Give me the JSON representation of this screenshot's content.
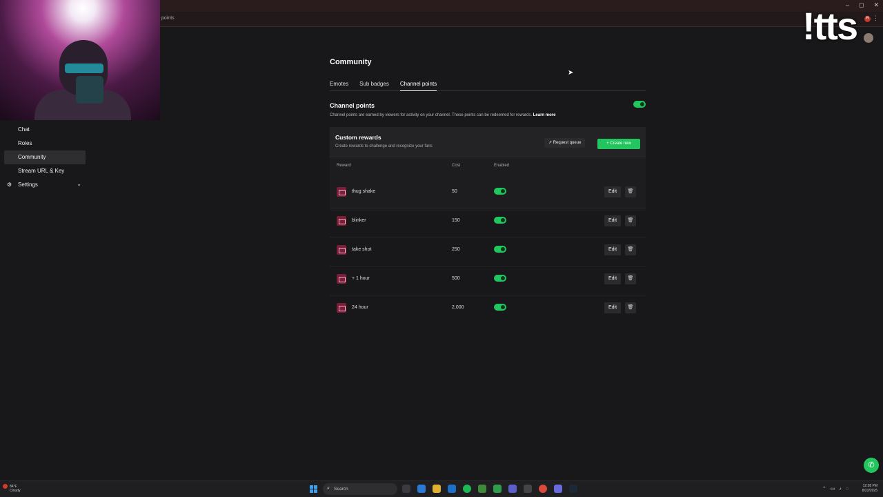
{
  "browser": {
    "url_fragment": "points",
    "window_controls": [
      "–",
      "◻",
      "✕"
    ],
    "extension_badge": "R"
  },
  "overlay": {
    "watermark": "!tts"
  },
  "sidebar": {
    "items": [
      {
        "label": "Chat",
        "active": false
      },
      {
        "label": "Roles",
        "active": false
      },
      {
        "label": "Community",
        "active": true
      },
      {
        "label": "Stream URL & Key",
        "active": false
      },
      {
        "label": "Settings",
        "active": false
      }
    ]
  },
  "page": {
    "title": "Community",
    "tabs": [
      {
        "label": "Emotes",
        "active": false
      },
      {
        "label": "Sub badges",
        "active": false
      },
      {
        "label": "Channel points",
        "active": true
      }
    ]
  },
  "channel_points": {
    "title": "Channel points",
    "description": "Channel points are earned by viewers for activity on your channel. These points can be redeemed for rewards.",
    "learn_more": "Learn more",
    "enabled": true
  },
  "custom_rewards": {
    "title": "Custom rewards",
    "subtitle": "Create rewards to challenge and recognize your fans",
    "request_queue_label": "Request queue",
    "create_new_label": "Create new",
    "columns": {
      "reward": "Reward",
      "cost": "Cost",
      "enabled": "Enabled"
    },
    "edit_label": "Edit",
    "delete_glyph": "🗑",
    "rows": [
      {
        "name": "thug shake",
        "cost": "50",
        "enabled": true
      },
      {
        "name": "blinker",
        "cost": "150",
        "enabled": true
      },
      {
        "name": "take shot",
        "cost": "250",
        "enabled": true
      },
      {
        "name": "+ 1 hour",
        "cost": "500",
        "enabled": true
      },
      {
        "name": "24 hour",
        "cost": "2,000",
        "enabled": true
      }
    ]
  },
  "taskbar": {
    "weather_line1": "84°F",
    "weather_line2": "Cloudy",
    "search_placeholder": "Search",
    "clock_time": "12:38 PM",
    "clock_date": "8/22/2025"
  },
  "colors": {
    "accent": "#22c55e",
    "background": "#18181a",
    "reward_icon": "#7a1f3a"
  }
}
